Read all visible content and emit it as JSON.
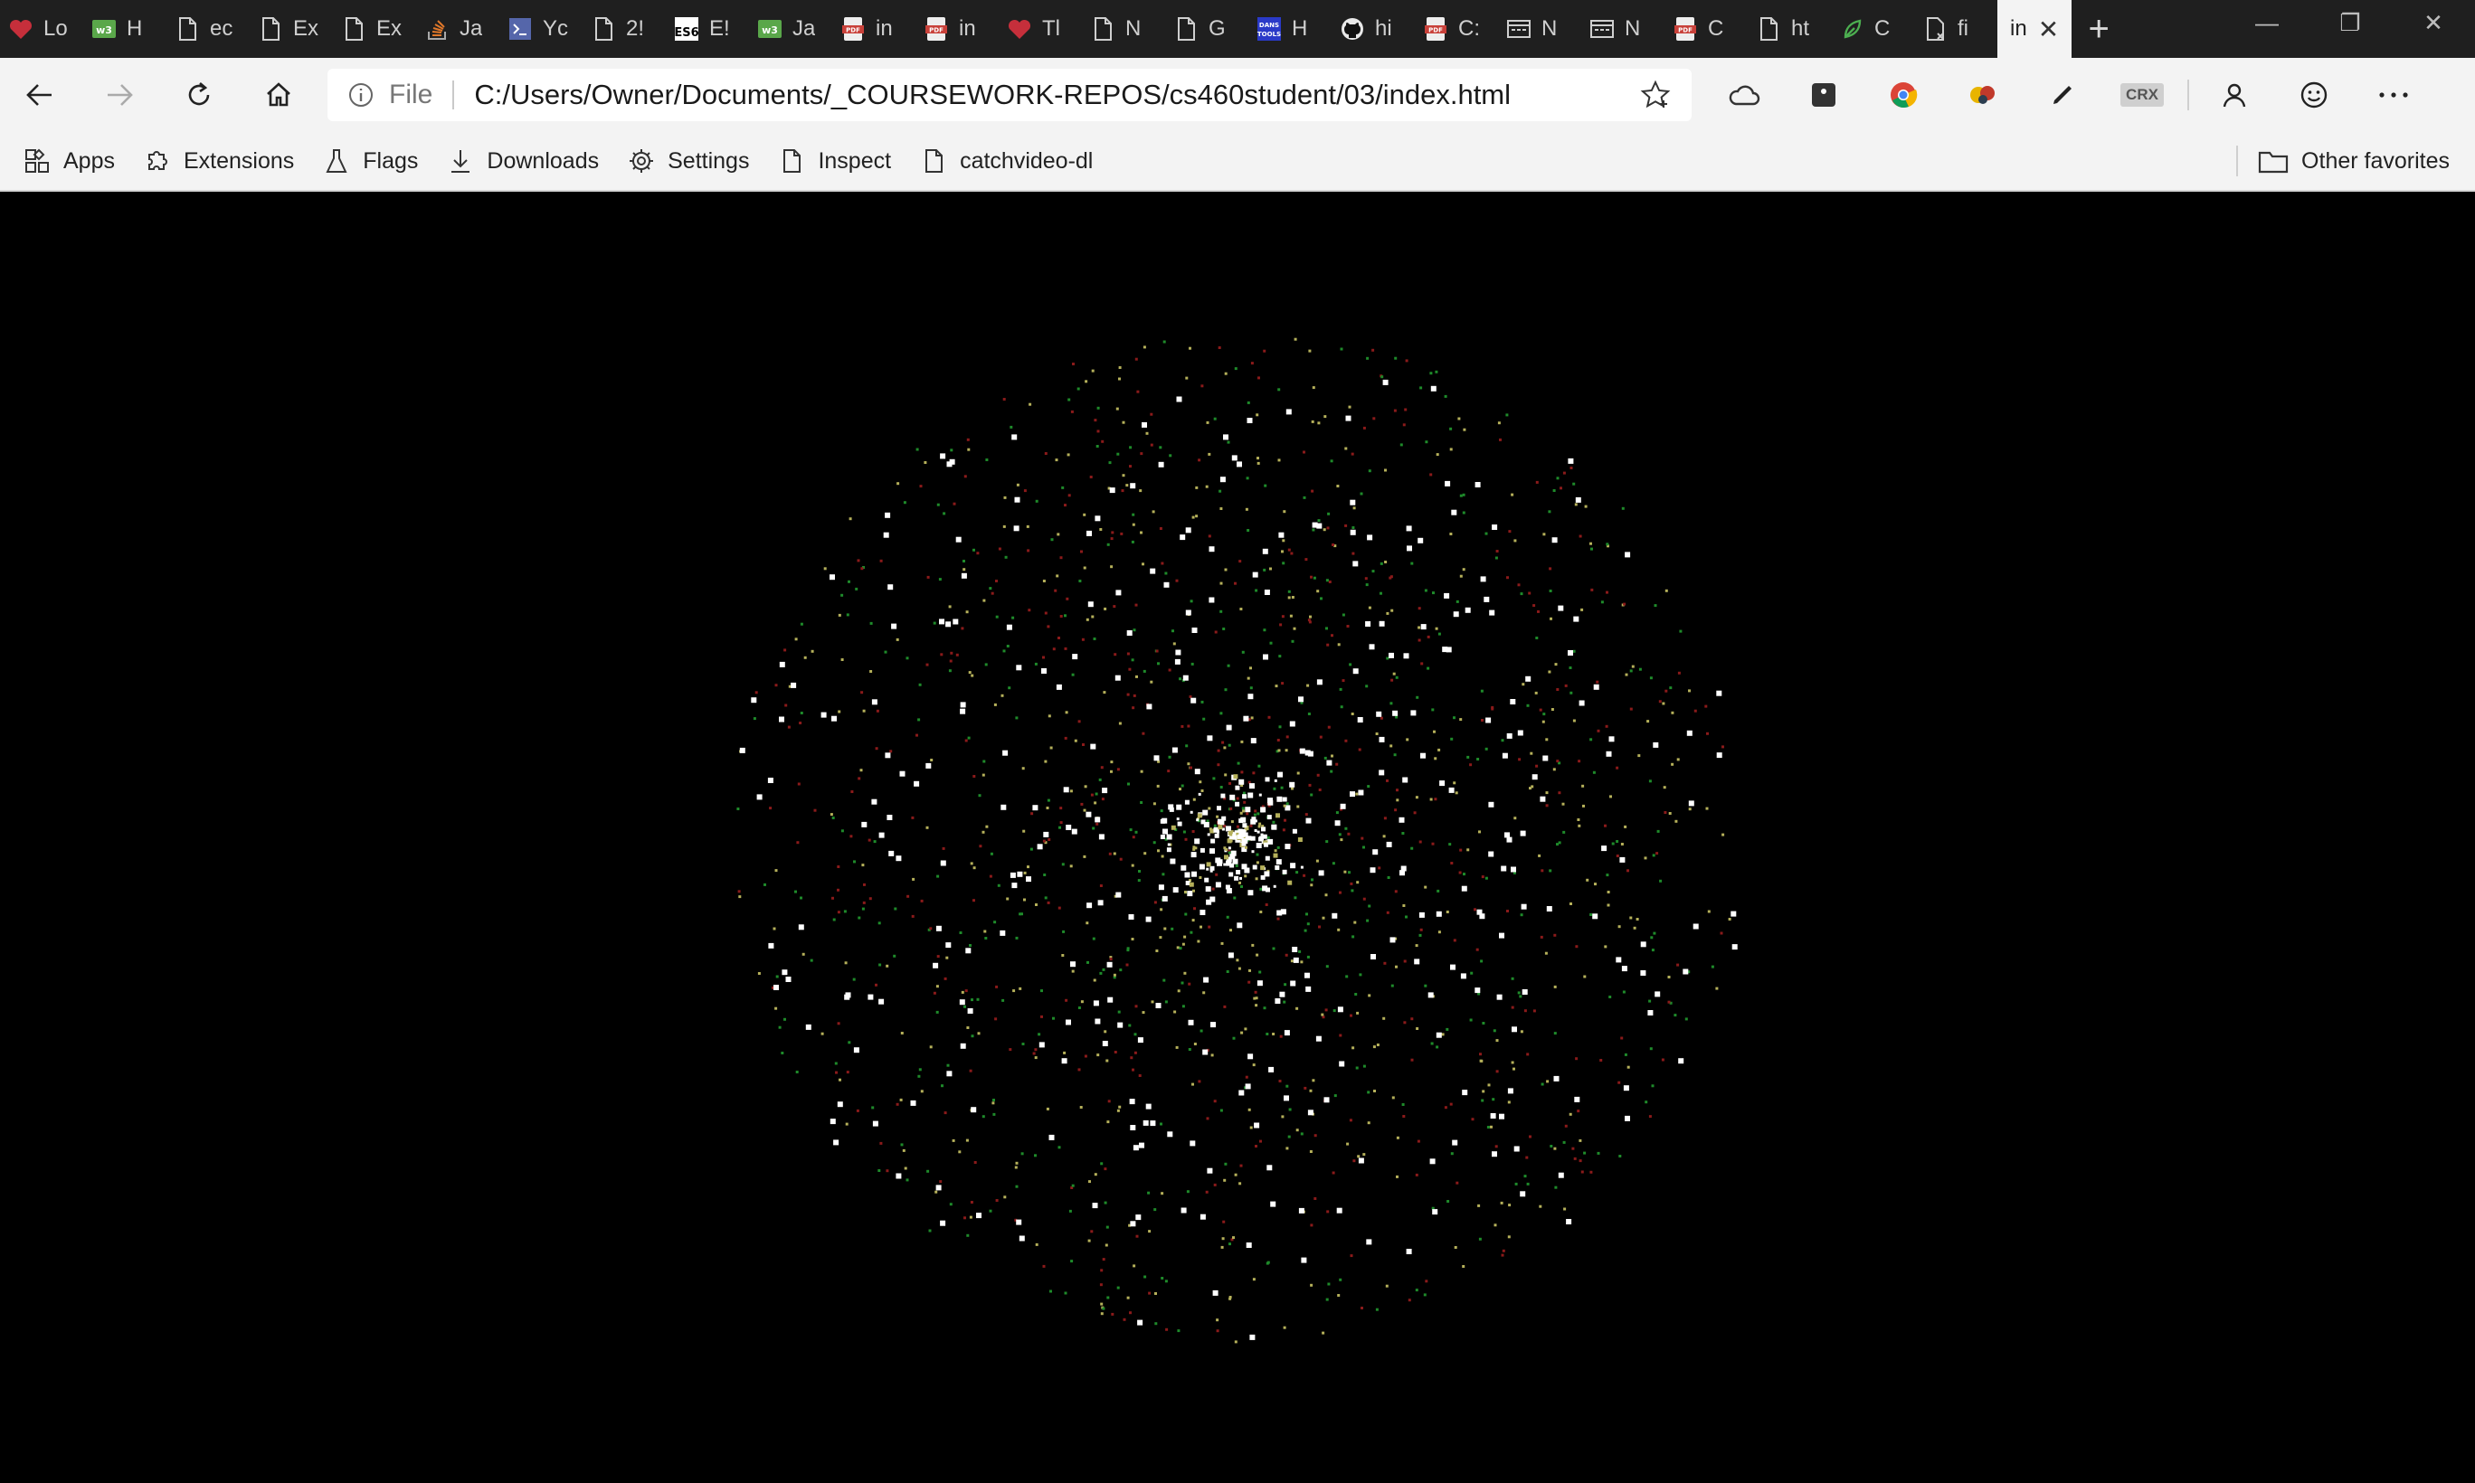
{
  "tabs": [
    {
      "label": "Lo",
      "icon": "heart-icon",
      "color": "#c62f3b"
    },
    {
      "label": "H",
      "icon": "w3-icon",
      "color": "#5aa74a"
    },
    {
      "label": "ec",
      "icon": "page-icon",
      "color": "#cfcfcf"
    },
    {
      "label": "Ex",
      "icon": "page-icon",
      "color": "#cfcfcf"
    },
    {
      "label": "Ex",
      "icon": "page-icon",
      "color": "#cfcfcf"
    },
    {
      "label": "Ja",
      "icon": "stackoverflow-icon",
      "color": "#e0782a"
    },
    {
      "label": "Yc",
      "icon": "terminal-icon",
      "color": "#5566aa"
    },
    {
      "label": "2!",
      "icon": "page-icon",
      "color": "#cfcfcf"
    },
    {
      "label": "E!",
      "icon": "es6-icon",
      "color": "#f2d848"
    },
    {
      "label": "Ja",
      "icon": "w3-icon",
      "color": "#5aa74a"
    },
    {
      "label": "in",
      "icon": "pdf-icon",
      "color": "#c8413a"
    },
    {
      "label": "in",
      "icon": "pdf-icon",
      "color": "#c8413a"
    },
    {
      "label": "Tl",
      "icon": "heart-icon",
      "color": "#c62f3b"
    },
    {
      "label": "N",
      "icon": "page-icon",
      "color": "#cfcfcf"
    },
    {
      "label": "G",
      "icon": "page-icon",
      "color": "#cfcfcf"
    },
    {
      "label": "H",
      "icon": "danstools-icon",
      "color": "#2a3ac8"
    },
    {
      "label": "hi",
      "icon": "github-icon",
      "color": "#e8e8e8"
    },
    {
      "label": "C:",
      "icon": "pdf-icon",
      "color": "#c8413a"
    },
    {
      "label": "N",
      "icon": "window-icon",
      "color": "#cfcfcf"
    },
    {
      "label": "N",
      "icon": "window-icon",
      "color": "#cfcfcf"
    },
    {
      "label": "C",
      "icon": "pdf-icon",
      "color": "#c8413a"
    },
    {
      "label": "ht",
      "icon": "page-icon",
      "color": "#cfcfcf"
    },
    {
      "label": "C",
      "icon": "leaf-icon",
      "color": "#4caf50"
    },
    {
      "label": "fi",
      "icon": "broken-page-icon",
      "color": "#cfcfcf"
    }
  ],
  "active_tab": {
    "label": "in"
  },
  "address_bar": {
    "scheme": "File",
    "url": "C:/Users/Owner/Documents/_COURSEWORK-REPOS/cs460student/03/index.html"
  },
  "favorites": [
    {
      "label": "Apps",
      "icon": "apps-grid-icon"
    },
    {
      "label": "Extensions",
      "icon": "puzzle-icon"
    },
    {
      "label": "Flags",
      "icon": "flask-icon"
    },
    {
      "label": "Downloads",
      "icon": "download-icon"
    },
    {
      "label": "Settings",
      "icon": "gear-icon"
    },
    {
      "label": "Inspect",
      "icon": "page-icon"
    },
    {
      "label": "catchvideo-dl",
      "icon": "page-icon"
    }
  ],
  "other_favorites": "Other favorites",
  "toolbar": {
    "crx_label": "CRX"
  },
  "canvas": {
    "background": "#000000",
    "particle_colors": [
      "#ffffff",
      "#1e8a2a",
      "#8a1a1a",
      "#b5b05a"
    ]
  }
}
